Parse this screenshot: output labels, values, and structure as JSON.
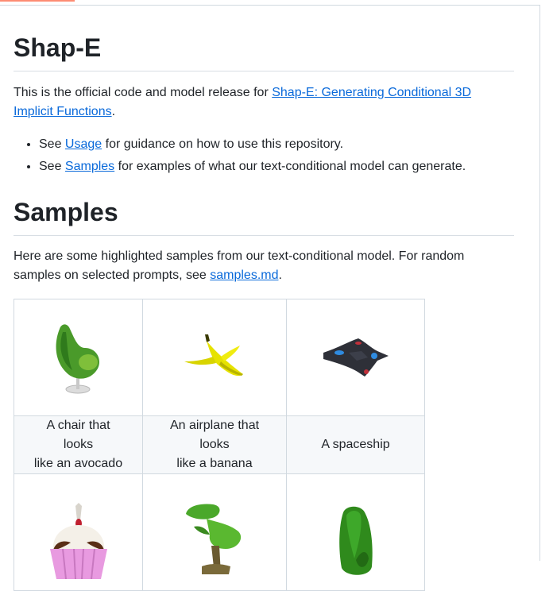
{
  "readme": {
    "title": "Shap-E",
    "intro": {
      "text_before": "This is the official code and model release for ",
      "link_text": "Shap-E: Generating Conditional 3D Implicit Functions",
      "text_after": "."
    },
    "bullets": [
      {
        "prefix": "See ",
        "link": "Usage",
        "suffix": " for guidance on how to use this repository."
      },
      {
        "prefix": "See ",
        "link": "Samples",
        "suffix": " for examples of what our text-conditional model can generate."
      }
    ]
  },
  "samples": {
    "title": "Samples",
    "intro": {
      "text_before": "Here are some highlighted samples from our text-conditional model. For random samples on selected prompts, see ",
      "link_text": "samples.md",
      "text_after": "."
    },
    "grid": [
      {
        "caption_line1": "A chair that looks",
        "caption_line2": "like an avocado",
        "image": "avocado-chair"
      },
      {
        "caption_line1": "An airplane that looks",
        "caption_line2": "like a banana",
        "image": "banana-airplane"
      },
      {
        "caption_line1": "A spaceship",
        "caption_line2": "",
        "image": "spaceship"
      },
      {
        "caption_line1": "",
        "caption_line2": "",
        "image": "cupcake"
      },
      {
        "caption_line1": "",
        "caption_line2": "",
        "image": "green-tree"
      },
      {
        "caption_line1": "",
        "caption_line2": "",
        "image": "green-blob"
      }
    ]
  },
  "colors": {
    "link": "#0969da",
    "border": "#d1d9e0",
    "tab_accent": "#fd8c73"
  }
}
